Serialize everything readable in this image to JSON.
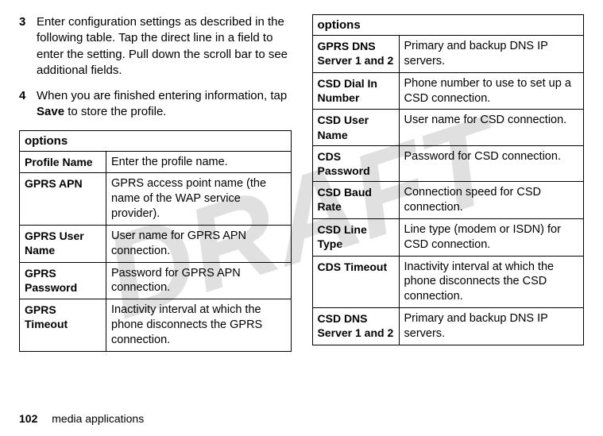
{
  "watermark": "DRAFT",
  "steps": {
    "s3_num": "3",
    "s3_text_a": "Enter configuration settings as described in the following table. Tap the direct line in a field to enter the setting. Pull down the scroll bar to see additional fields.",
    "s4_num": "4",
    "s4_text_a": "When you are finished entering information, tap ",
    "s4_save": "Save",
    "s4_text_b": " to store the profile."
  },
  "left_table": {
    "header": "options",
    "rows": [
      {
        "k": "Profile Name",
        "v": "Enter the profile name."
      },
      {
        "k": "GPRS APN",
        "v": "GPRS access point name (the name of the WAP service provider)."
      },
      {
        "k": "GPRS User Name",
        "v": "User name for GPRS APN connection."
      },
      {
        "k": "GPRS Password",
        "v": "Password for GPRS APN connection."
      },
      {
        "k": "GPRS Timeout",
        "v": "Inactivity interval at which the phone disconnects the GPRS connection."
      }
    ]
  },
  "right_table": {
    "header": "options",
    "rows": [
      {
        "k": "GPRS DNS Server 1 and 2",
        "v": "Primary and backup DNS IP servers."
      },
      {
        "k": "CSD Dial In Number",
        "v": "Phone number to use to set up a CSD connection."
      },
      {
        "k": "CSD User Name",
        "v": "User name for CSD connection."
      },
      {
        "k": "CDS Password",
        "v": "Password for CSD connection."
      },
      {
        "k": "CSD Baud Rate",
        "v": "Connection speed for CSD connection."
      },
      {
        "k": "CSD Line Type",
        "v": "Line type (modem or ISDN) for CSD connection."
      },
      {
        "k": "CDS Timeout",
        "v": "Inactivity interval at which the phone disconnects the CSD connection."
      },
      {
        "k": "CSD DNS Server 1 and 2",
        "v": "Primary and backup DNS IP servers."
      }
    ]
  },
  "footer": {
    "page": "102",
    "section": "media applications"
  }
}
